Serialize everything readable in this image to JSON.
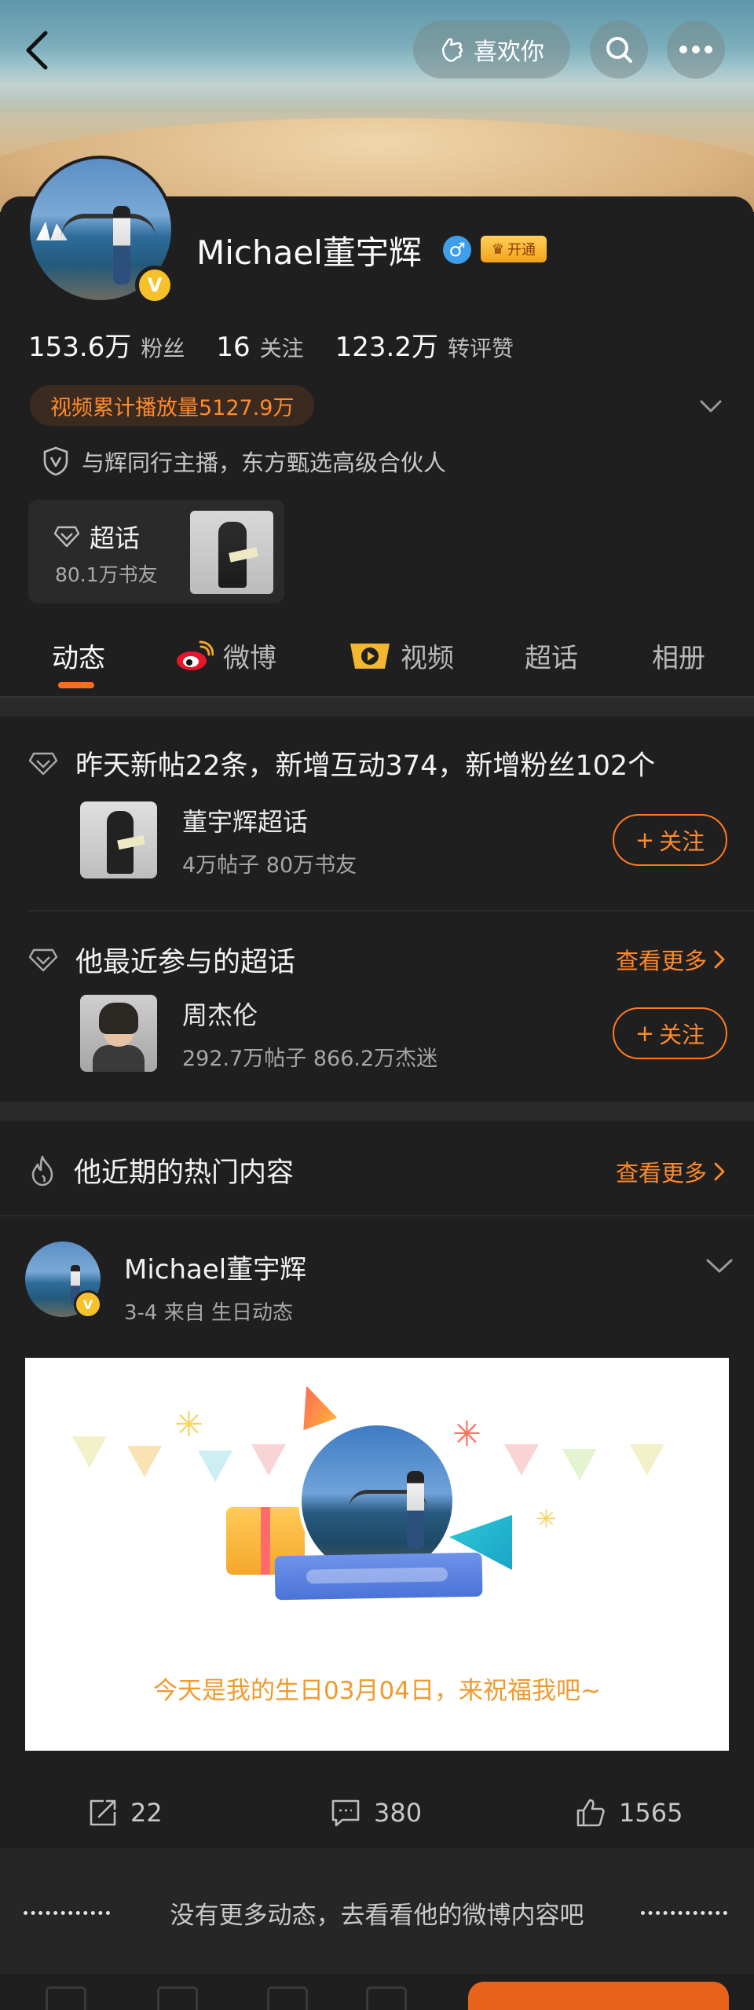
{
  "header": {
    "like_label": "喜欢你"
  },
  "profile": {
    "name": "Michael董宇辉",
    "gender_symbol": "♂",
    "vip_label": "开通",
    "verified_mark": "V",
    "stats": [
      {
        "value": "153.6万",
        "label": "粉丝"
      },
      {
        "value": "16",
        "label": "关注"
      },
      {
        "value": "123.2万",
        "label": "转评赞"
      }
    ],
    "play_count_label": "视频累计播放量5127.9万",
    "certification": "与辉同行主播，东方甄选高级合伙人",
    "chaohua": {
      "title": "超话",
      "subtitle": "80.1万书友"
    }
  },
  "tabs": [
    {
      "label": "动态",
      "active": true
    },
    {
      "label": "微博",
      "active": false
    },
    {
      "label": "视频",
      "active": false
    },
    {
      "label": "超话",
      "active": false
    },
    {
      "label": "相册",
      "active": false
    }
  ],
  "supertopic_summary": {
    "headline": "昨天新帖22条，新增互动374，新增粉丝102个",
    "item": {
      "name": "董宇辉超话",
      "meta": "4万帖子 80万书友",
      "follow_label": "关注"
    }
  },
  "recent_supertopics": {
    "headline": "他最近参与的超话",
    "more_label": "查看更多",
    "item": {
      "name": "周杰伦",
      "meta": "292.7万帖子 866.2万杰迷",
      "follow_label": "关注"
    }
  },
  "hot_content": {
    "headline": "他近期的热门内容",
    "more_label": "查看更多"
  },
  "post": {
    "author": "Michael董宇辉",
    "meta": "3-4  来自 生日动态",
    "card_text": "今天是我的生日03月04日，来祝福我吧~",
    "reposts": "22",
    "comments": "380",
    "likes": "1565"
  },
  "footer": {
    "no_more_text": "没有更多动态，去看看他的微博内容吧"
  },
  "colors": {
    "accent_orange": "#ff8a2b",
    "verified_gold": "#f6c12a",
    "gender_blue": "#3f9eea",
    "background": "#1f1f1f"
  }
}
